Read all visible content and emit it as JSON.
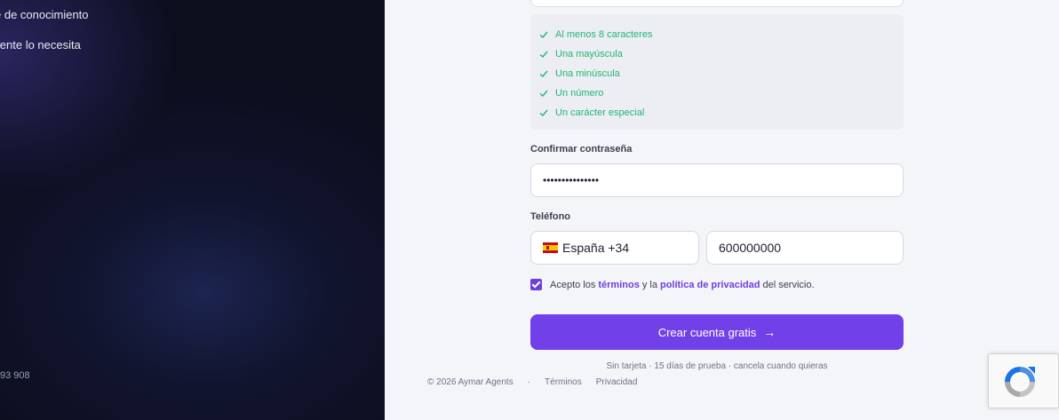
{
  "left": {
    "features": [
      "e de conocimiento",
      "liente lo necesita"
    ],
    "phone_fragment": "93 908"
  },
  "requirements": [
    "Al menos 8 caracteres",
    "Una mayúscula",
    "Una minúscula",
    "Un número",
    "Un carácter especial"
  ],
  "confirm": {
    "label": "Confirmar contraseña",
    "value": "•••••••••••••••"
  },
  "phone": {
    "label": "Teléfono",
    "country": "España +34",
    "number": "600000000"
  },
  "consent": {
    "prefix": "Acepto los",
    "terms_link": "términos",
    "middle": "y la",
    "privacy_link": "política de privacidad",
    "suffix": "del servicio."
  },
  "submit_label": "Crear cuenta gratis",
  "footnote": "Sin tarjeta · 15 días de prueba · cancela cuando quieras",
  "footer": {
    "copyright": "© 2026 Aymar Agents",
    "separator": "·",
    "terms": "Términos",
    "privacy": "Privacidad"
  },
  "colors": {
    "accent": "#7240e8",
    "success": "#22b573",
    "left_bg": "#0c0e1e"
  },
  "icons": {
    "requirement": "check-icon",
    "submit": "arrow-right-icon",
    "captcha": "recaptcha-icon",
    "country": "spain-flag-icon"
  }
}
